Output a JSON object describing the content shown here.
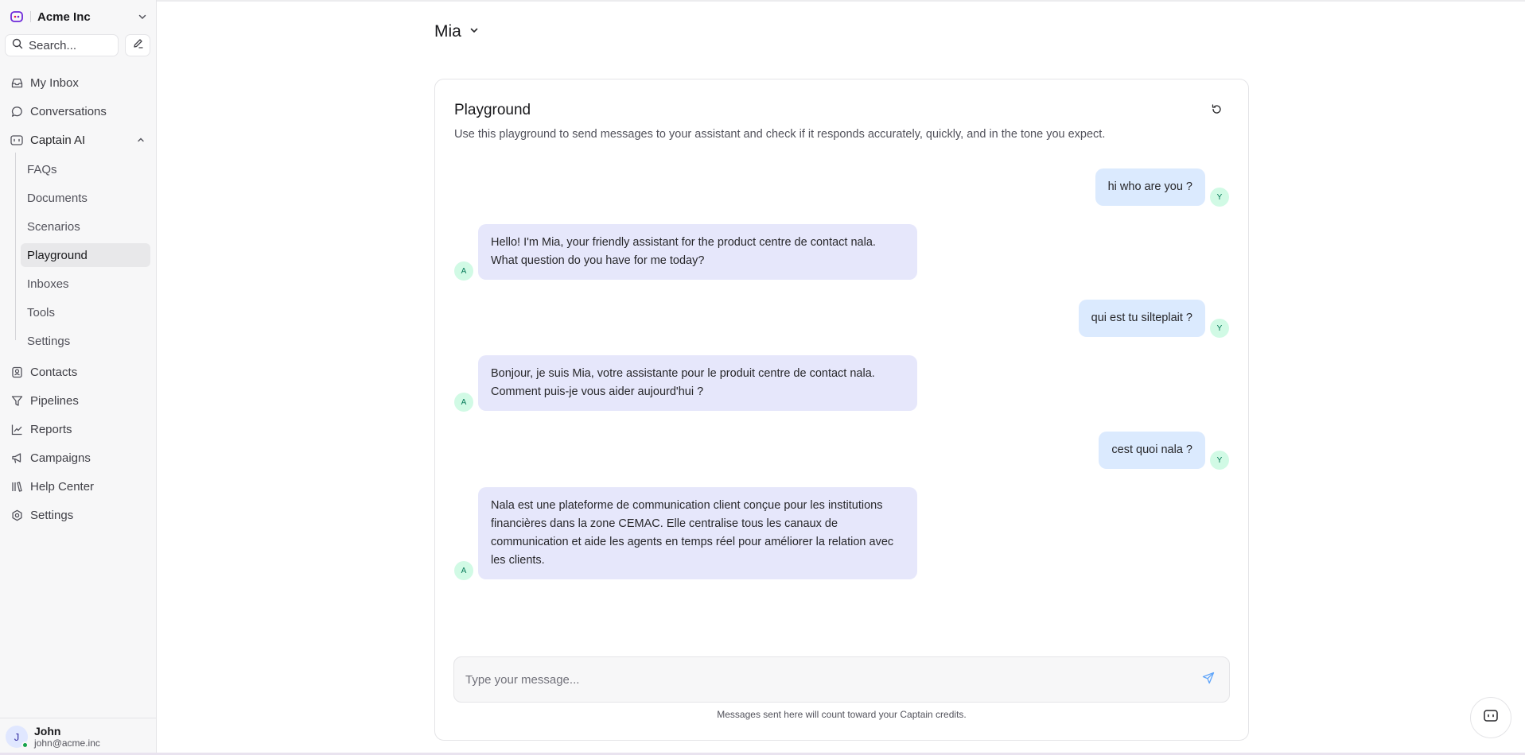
{
  "account": {
    "name": "Acme Inc",
    "logo_icon": "acme-logo"
  },
  "search": {
    "placeholder": "Search..."
  },
  "nav": {
    "my_inbox": "My Inbox",
    "conversations": "Conversations",
    "captain_ai": "Captain AI",
    "captain_sub": {
      "faqs": "FAQs",
      "documents": "Documents",
      "scenarios": "Scenarios",
      "playground": "Playground",
      "inboxes": "Inboxes",
      "tools": "Tools",
      "settings": "Settings"
    },
    "contacts": "Contacts",
    "pipelines": "Pipelines",
    "reports": "Reports",
    "campaigns": "Campaigns",
    "help_center": "Help Center",
    "settings": "Settings"
  },
  "user": {
    "initial": "J",
    "name": "John",
    "email": "john@acme.inc",
    "status_color": "#16a34a"
  },
  "assistant": {
    "name": "Mia"
  },
  "playground": {
    "title": "Playground",
    "description": "Use this playground to send messages to your assistant and check if it responds accurately, quickly, and in the tone you expect.",
    "messages": [
      {
        "role": "user",
        "avatar": "Y",
        "text": "hi who are you ?"
      },
      {
        "role": "assistant",
        "avatar": "A",
        "text": "Hello! I'm Mia, your friendly assistant for the product centre de contact nala. What question do you have for me today?"
      },
      {
        "role": "user",
        "avatar": "Y",
        "text": "qui est tu silteplait ?"
      },
      {
        "role": "assistant",
        "avatar": "A",
        "text": "Bonjour, je suis Mia, votre assistante pour le produit centre de contact nala. Comment puis-je vous aider aujourd'hui ?"
      },
      {
        "role": "user",
        "avatar": "Y",
        "text": "cest quoi nala ?"
      },
      {
        "role": "assistant",
        "avatar": "A",
        "text": "Nala est une plateforme de communication client conçue pour les institutions financières dans la zone CEMAC. Elle centralise tous les canaux de communication et aide les agents en temps réel pour améliorer la relation avec les clients."
      }
    ],
    "input_placeholder": "Type your message...",
    "credits_note": "Messages sent here will count toward your Captain credits."
  },
  "colors": {
    "user_bubble": "#dbeafe",
    "assistant_bubble": "#e6e7fb",
    "avatar_bg": "#d1fae5",
    "brand": "#6d28d9"
  }
}
